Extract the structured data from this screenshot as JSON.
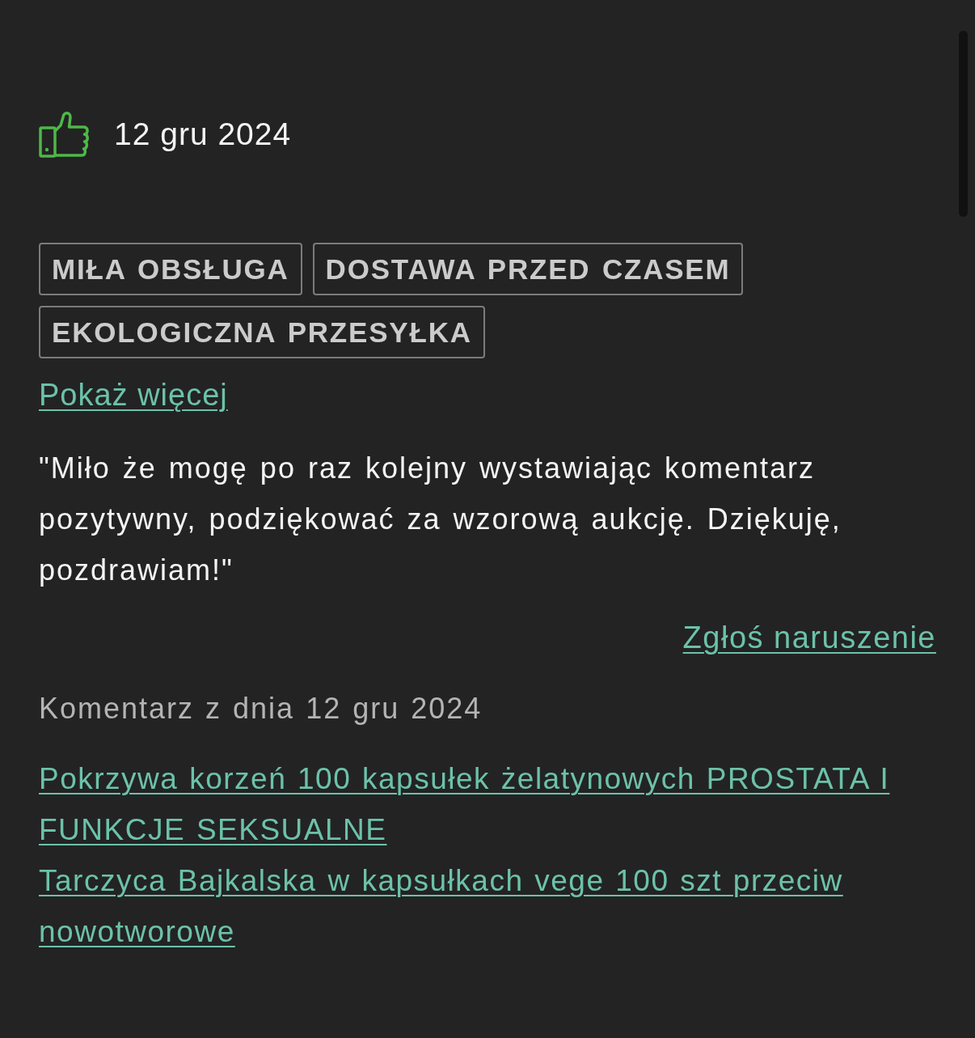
{
  "review": {
    "positive": true,
    "date": "12 gru 2024",
    "tags": [
      "MIŁA OBSŁUGA",
      "DOSTAWA PRZED CZASEM",
      "EKOLOGICZNA PRZESYŁKA"
    ],
    "show_more": "Pokaż więcej",
    "comment": "\"Miło że mogę po raz kolejny wystawiając komentarz pozytywny, podziękować za wzorową aukcję. Dziękuję, pozdrawiam!\"",
    "report_link": "Zgłoś naruszenie",
    "comment_date": "Komentarz z dnia 12 gru 2024",
    "products": [
      "Pokrzywa korzeń 100 kapsułek żelatynowych PROSTATA I FUNKCJE SEKSUALNE",
      "Tarczyca Bajkalska w kapsułkach vege 100 szt przeciw nowotworowe"
    ]
  }
}
